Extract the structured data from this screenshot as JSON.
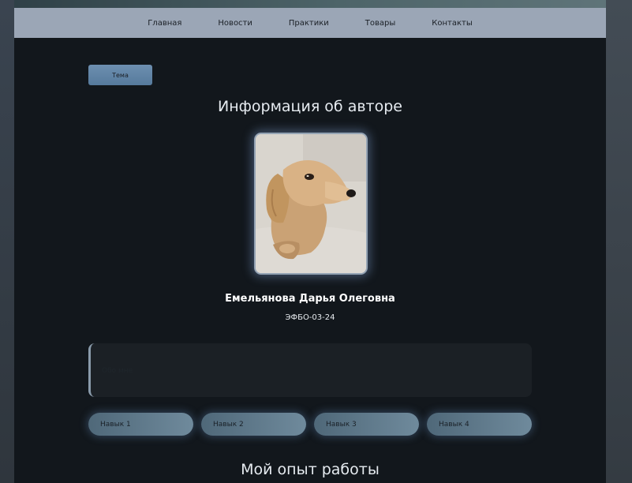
{
  "nav": {
    "items": [
      {
        "label": "Главная"
      },
      {
        "label": "Новости"
      },
      {
        "label": "Практики"
      },
      {
        "label": "Товары"
      },
      {
        "label": "Контакты"
      }
    ]
  },
  "theme_button": {
    "label": "Тема"
  },
  "author_section": {
    "title": "Информация об авторе",
    "name": "Емельянова Дарья Олеговна",
    "group": "ЭФБО-03-24"
  },
  "about": {
    "text": "Обо мне"
  },
  "skills": [
    {
      "label": "Навык 1"
    },
    {
      "label": "Навык 2"
    },
    {
      "label": "Навык 3"
    },
    {
      "label": "Навык 4"
    }
  ],
  "work_section": {
    "title": "Мой опыт работы"
  },
  "colors": {
    "navbar": "#9ba6b6",
    "page_background": "#12171c",
    "accent": "#6d8fb0",
    "skill_pill": "#5f7a8c"
  }
}
